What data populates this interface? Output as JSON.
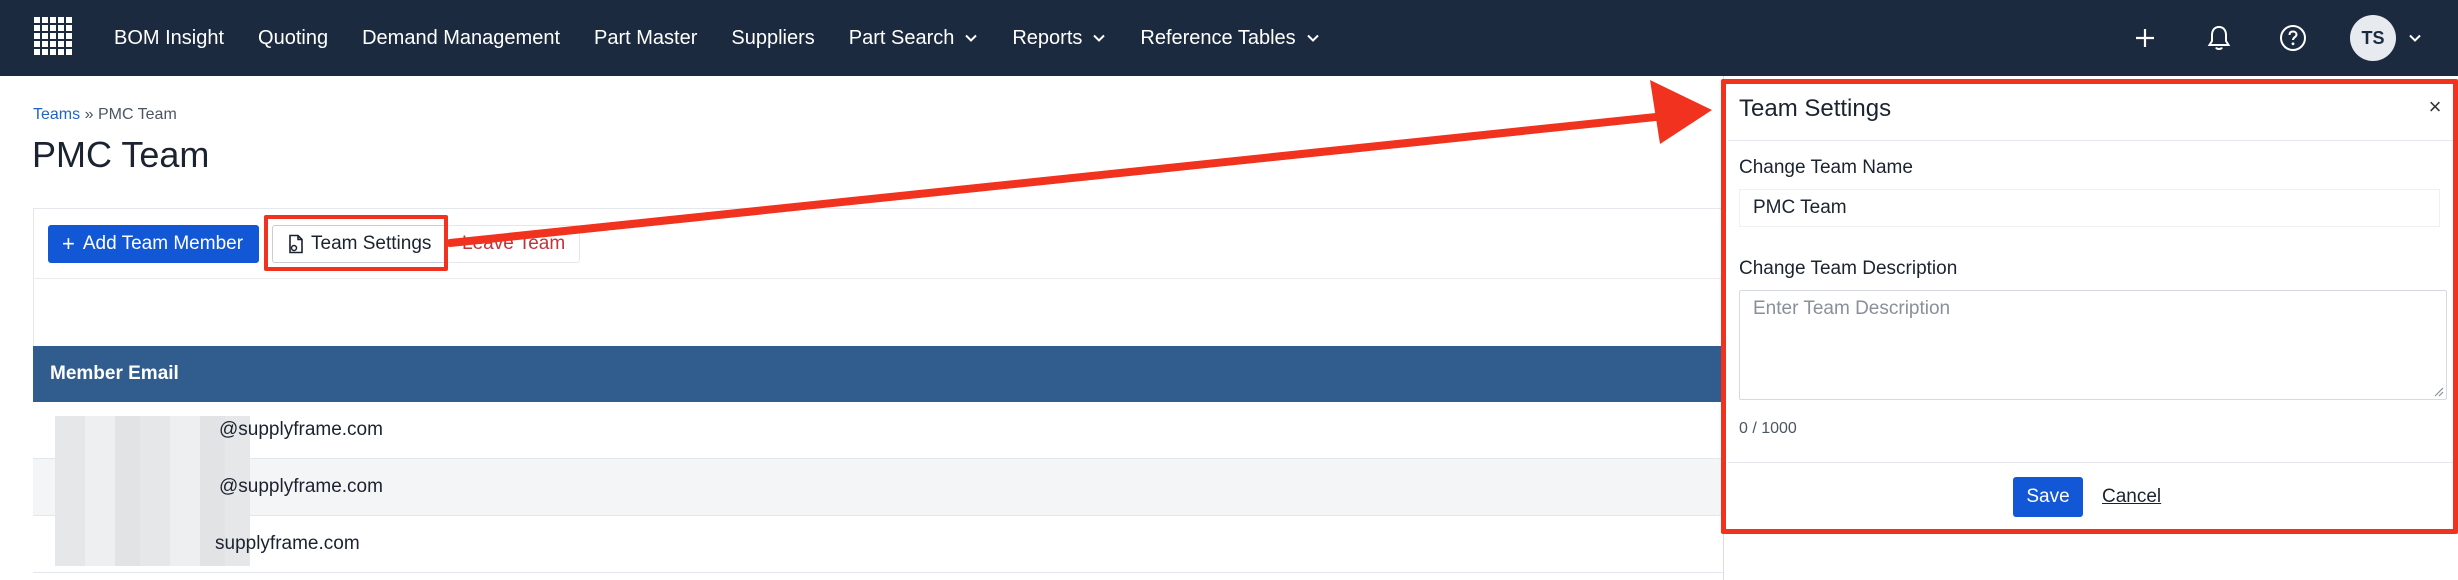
{
  "nav": {
    "logo_icon": "grid-logo-icon",
    "items": [
      {
        "label": "BOM Insight",
        "has_menu": false
      },
      {
        "label": "Quoting",
        "has_menu": false
      },
      {
        "label": "Demand Management",
        "has_menu": false
      },
      {
        "label": "Part Master",
        "has_menu": false
      },
      {
        "label": "Suppliers",
        "has_menu": false
      },
      {
        "label": "Part Search",
        "has_menu": true
      },
      {
        "label": "Reports",
        "has_menu": true
      },
      {
        "label": "Reference Tables",
        "has_menu": true
      }
    ],
    "right_icons": [
      "plus-icon",
      "bell-icon",
      "help-icon"
    ],
    "avatar_initials": "TS"
  },
  "breadcrumb": {
    "root": "Teams",
    "separator": "»",
    "current": "PMC Team"
  },
  "page": {
    "title": "PMC Team"
  },
  "toolbar": {
    "add_member_label": "Add Team Member",
    "settings_label": "Team Settings",
    "leave_label": "Leave Team"
  },
  "table": {
    "column_header": "Member Email",
    "rows": [
      {
        "email": "@supplyframe.com"
      },
      {
        "email": "@supplyframe.com"
      },
      {
        "email": "supplyframe.com"
      }
    ]
  },
  "panel": {
    "title": "Team Settings",
    "close_icon": "close-icon",
    "name_label": "Change Team Name",
    "name_value": "PMC Team",
    "description_label": "Change Team Description",
    "description_placeholder": "Enter Team Description",
    "counter": "0 / 1000",
    "save_label": "Save",
    "cancel_label": "Cancel"
  },
  "colors": {
    "nav_bg": "#1c2a3f",
    "primary": "#1257d6",
    "table_header": "#315c8e",
    "annotation": "#f0321e",
    "danger": "#c4323b"
  }
}
